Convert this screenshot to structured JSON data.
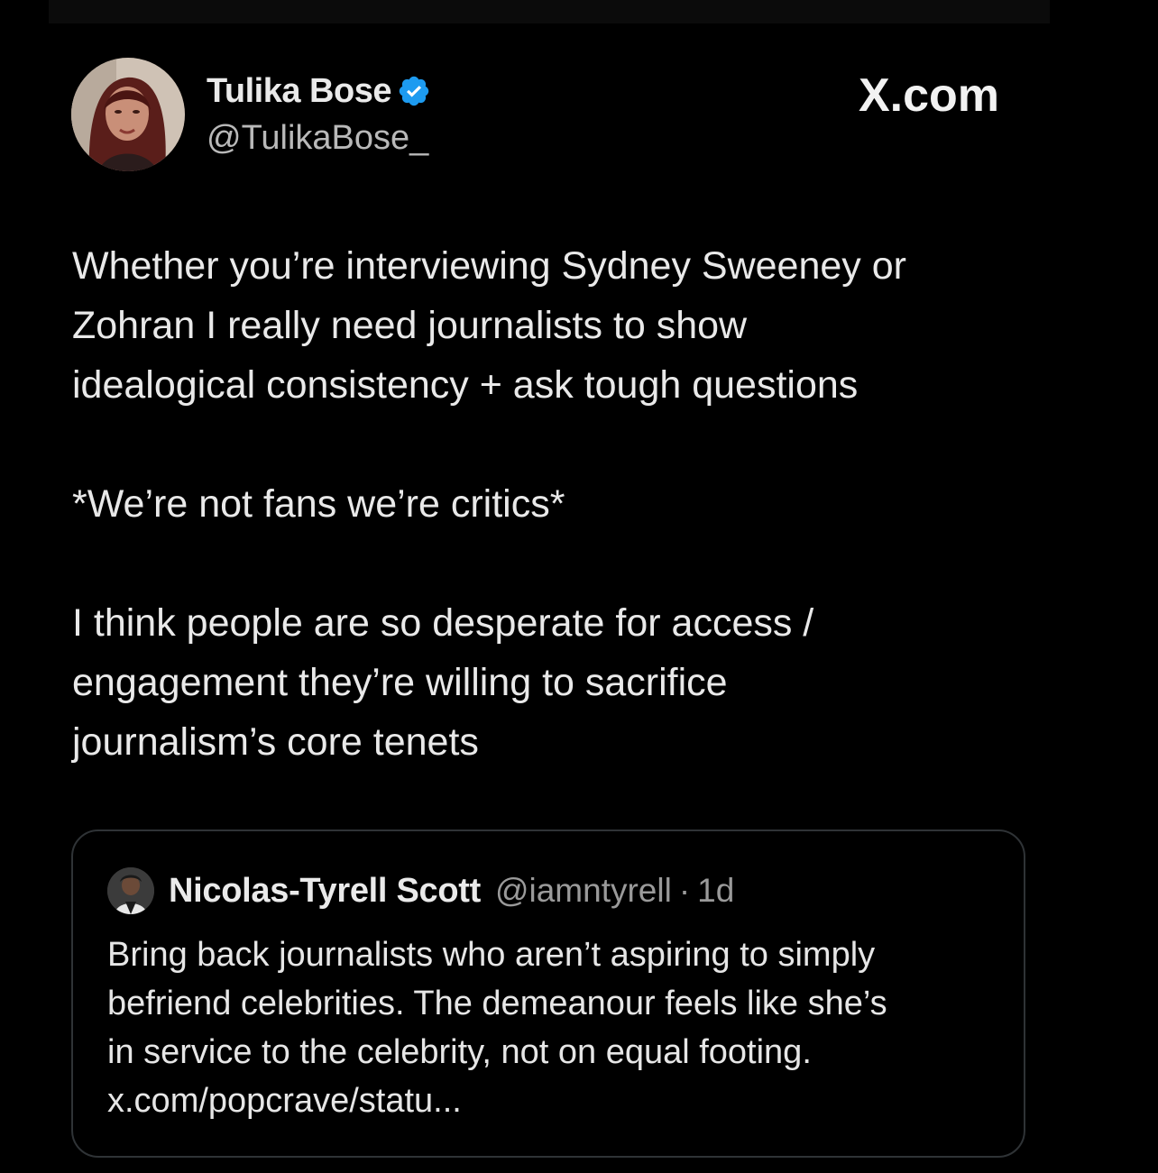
{
  "tweet": {
    "author": {
      "display_name": "Tulika Bose",
      "handle": "@TulikaBose_",
      "verified_icon": "verified-badge-icon",
      "avatar": "avatar-photo"
    },
    "brand": "X.com",
    "paragraphs": [
      "Whether you’re interviewing Sydney Sweeney or\nZohran I really need journalists to show\nidealogical consistency + ask tough questions",
      "*We’re not fans we’re critics*",
      "I think people are so desperate for access /\nengagement they’re willing to sacrifice\njournalism’s core tenets"
    ]
  },
  "quote": {
    "author": {
      "display_name": "Nicolas-Tyrell Scott",
      "handle": "@iamntyrell",
      "separator": "·",
      "time": "1d"
    },
    "lines": [
      "Bring back journalists who aren’t aspiring to simply",
      "befriend celebrities. The demeanour feels like she’s",
      "in service to the celebrity, not on equal footing.",
      "x.com/popcrave/statu..."
    ]
  },
  "colors": {
    "background": "#000000",
    "text": "#e7e9ea",
    "muted": "#9a9a9a",
    "verified": "#1d9bf0",
    "border": "#2f3336"
  }
}
